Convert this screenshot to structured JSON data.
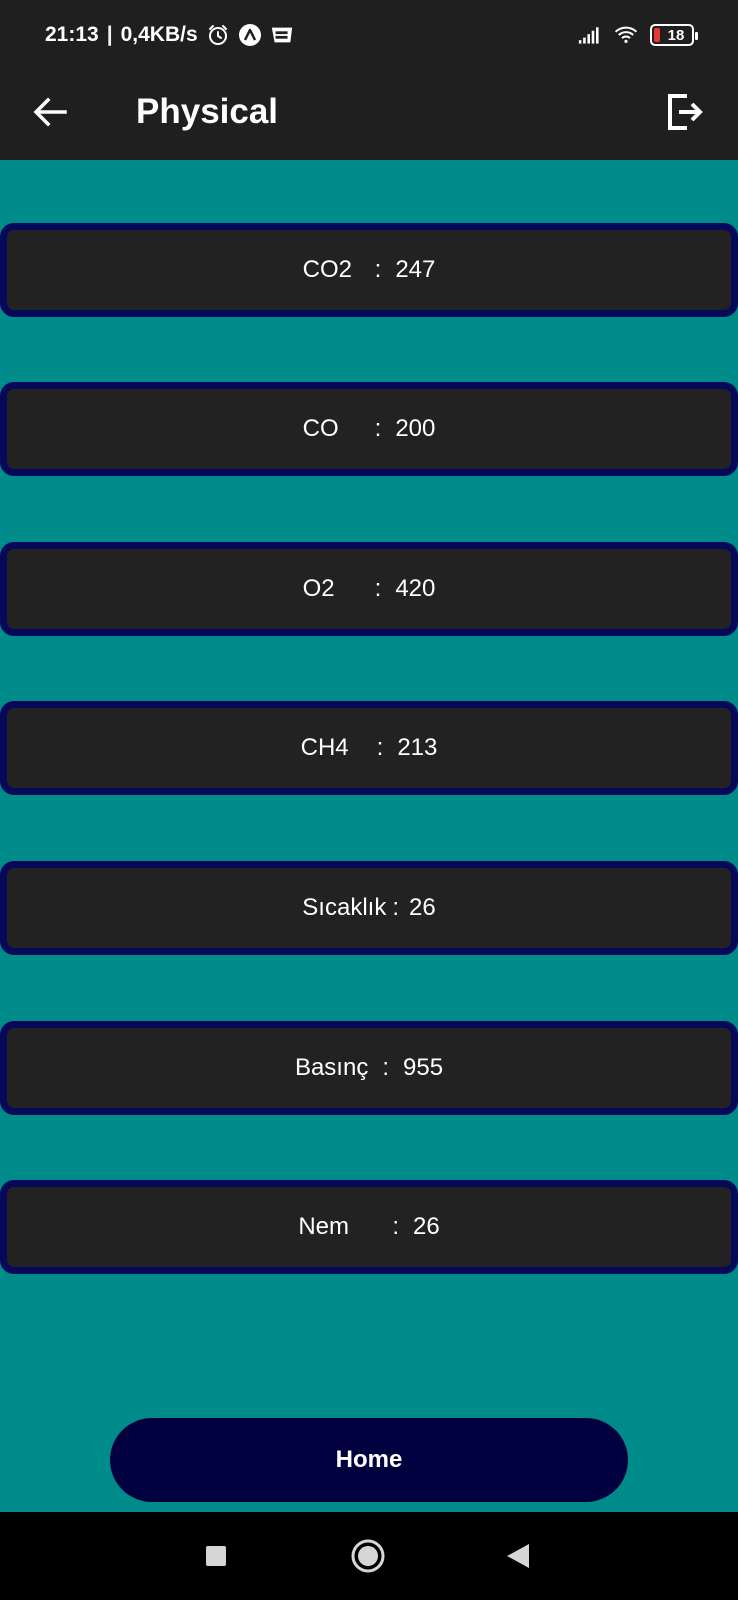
{
  "status_bar": {
    "time": "21:13",
    "separator": "|",
    "network_speed": "0,4KB/s",
    "icons": [
      "alarm-icon",
      "app-a-icon",
      "webtoon-icon"
    ],
    "battery_level": "18",
    "right_icons": [
      "signal-icon",
      "wifi-icon",
      "battery-icon"
    ]
  },
  "app_bar": {
    "title": "Physical",
    "back_icon": "arrow-left-icon",
    "logout_icon": "logout-icon"
  },
  "readings": [
    {
      "label": "CO2",
      "separator": ":",
      "value": "247"
    },
    {
      "label": "CO",
      "separator": ":",
      "value": "200"
    },
    {
      "label": "O2",
      "separator": ":",
      "value": "420"
    },
    {
      "label": "CH4",
      "separator": ":",
      "value": "213"
    },
    {
      "label": "Sıcaklık",
      "separator": ":",
      "value": "26"
    },
    {
      "label": "Basınç",
      "separator": ":",
      "value": "955"
    },
    {
      "label": "Nem",
      "separator": ":",
      "value": "26"
    }
  ],
  "home_button": {
    "label": "Home"
  },
  "nav_bar": {
    "icons": [
      "recents-square-icon",
      "home-circle-icon",
      "back-triangle-icon"
    ]
  },
  "colors": {
    "background": "#008b8b",
    "app_bar": "#1f1f1f",
    "card": "#222222",
    "card_border": "#06085a",
    "home_button": "#00003f",
    "battery_low": "#e53935"
  }
}
